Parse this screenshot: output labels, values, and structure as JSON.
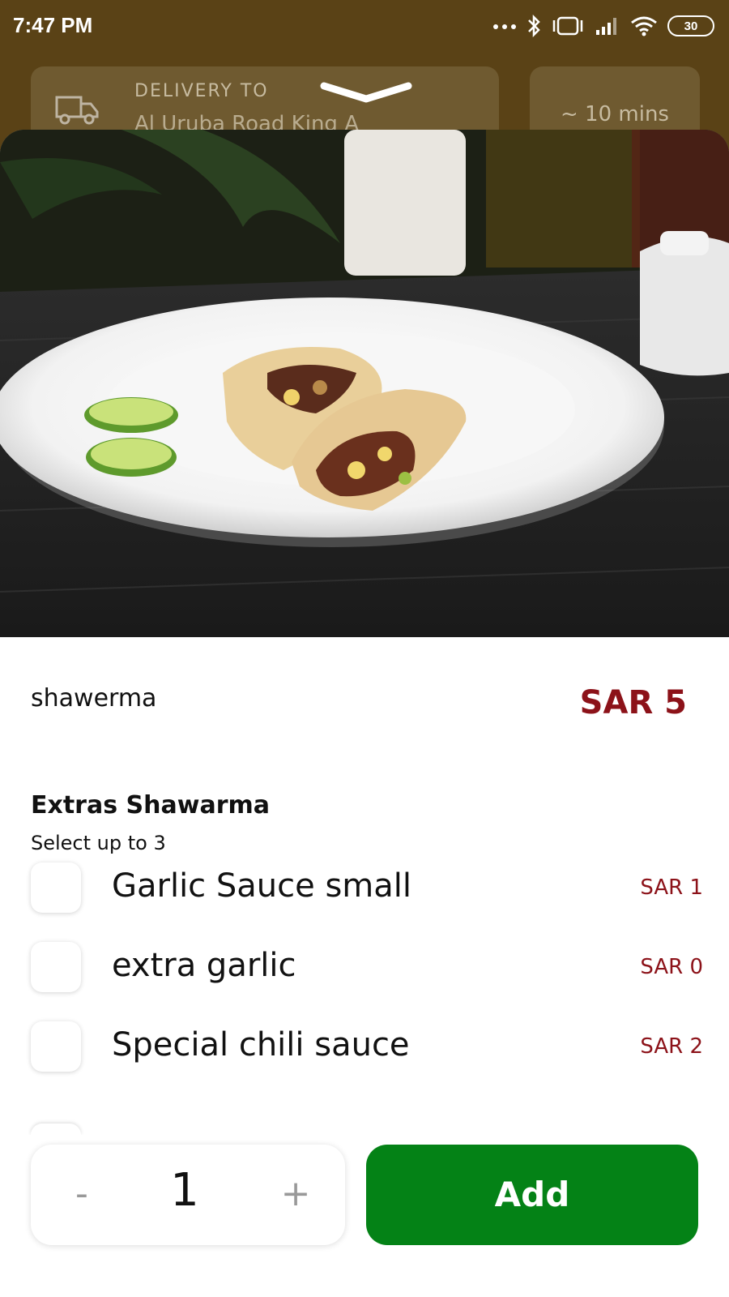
{
  "status_bar": {
    "time": "7:47 PM",
    "battery": "30"
  },
  "header": {
    "delivery_label": "DELIVERY TO",
    "delivery_address": "Al Uruba Road King A",
    "eta": "~ 10 mins"
  },
  "item": {
    "name": "shawerma",
    "price": "SAR 5"
  },
  "extras": {
    "title": "Extras Shawarma",
    "subtitle": "Select up to 3",
    "options": [
      {
        "label": "Garlic Sauce small",
        "price": "SAR 1",
        "checked": false
      },
      {
        "label": "extra garlic",
        "price": "SAR 0",
        "checked": false
      },
      {
        "label": "Special chili sauce",
        "price": "SAR 2",
        "checked": false
      }
    ]
  },
  "cart": {
    "minus": "-",
    "quantity": "1",
    "plus": "+",
    "add_label": "Add"
  },
  "colors": {
    "header_bg": "#5a4216",
    "price": "#8c1219",
    "add_button": "#048216"
  },
  "icons": {
    "status": [
      "more-icon",
      "bluetooth-icon",
      "vibrate-icon",
      "signal-icon",
      "wifi-icon",
      "battery-icon"
    ],
    "header": [
      "truck-icon",
      "chevron-down-icon"
    ]
  }
}
